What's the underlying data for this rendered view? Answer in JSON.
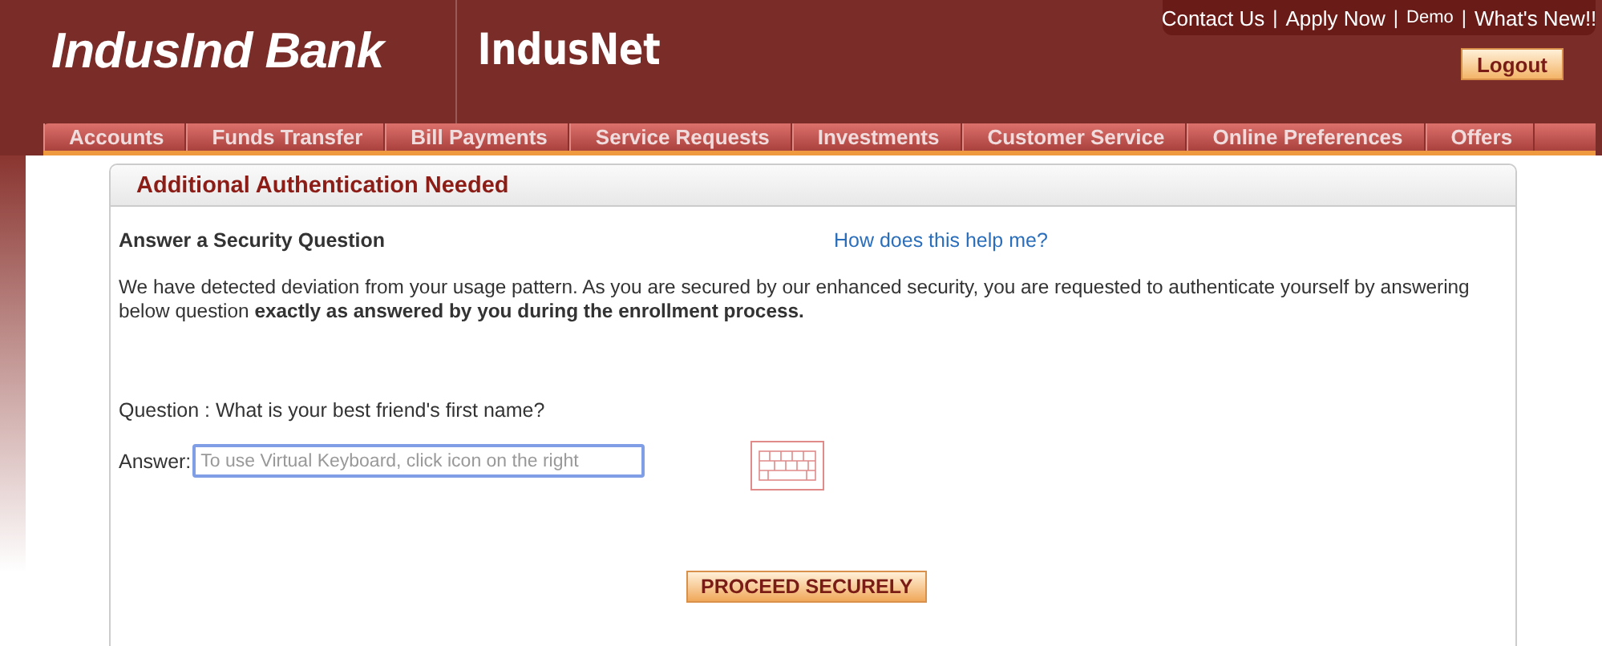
{
  "header": {
    "logo": "IndusInd Bank",
    "product": "IndusNet",
    "top_links": [
      {
        "label": "Contact Us",
        "kind": "link"
      },
      {
        "label": "|",
        "kind": "separator"
      },
      {
        "label": "Apply Now",
        "kind": "link"
      },
      {
        "label": "|",
        "kind": "separator"
      },
      {
        "label": "Demo",
        "kind": "small-link"
      },
      {
        "label": "|",
        "kind": "separator"
      },
      {
        "label": "What's New!!",
        "kind": "link"
      }
    ],
    "logout": "Logout"
  },
  "nav": [
    "Accounts",
    "Funds Transfer",
    "Bill Payments",
    "Service Requests",
    "Investments",
    "Customer Service",
    "Online Preferences",
    "Offers"
  ],
  "panel": {
    "title": "Additional Authentication Needed",
    "section_title": "Answer a Security Question",
    "help_link": "How does this help me?",
    "message": "We have detected deviation from your usage pattern. As you are secured by our enhanced security, you are requested to authenticate yourself by answering below question **exactly as answered by you during the enrollment process.**",
    "question": "Question : What is your best friend's first name?",
    "answer_label": "Answer:",
    "answer_placeholder": "To use Virtual Keyboard, click icon on the right",
    "proceed": "PROCEED SECURELY"
  }
}
